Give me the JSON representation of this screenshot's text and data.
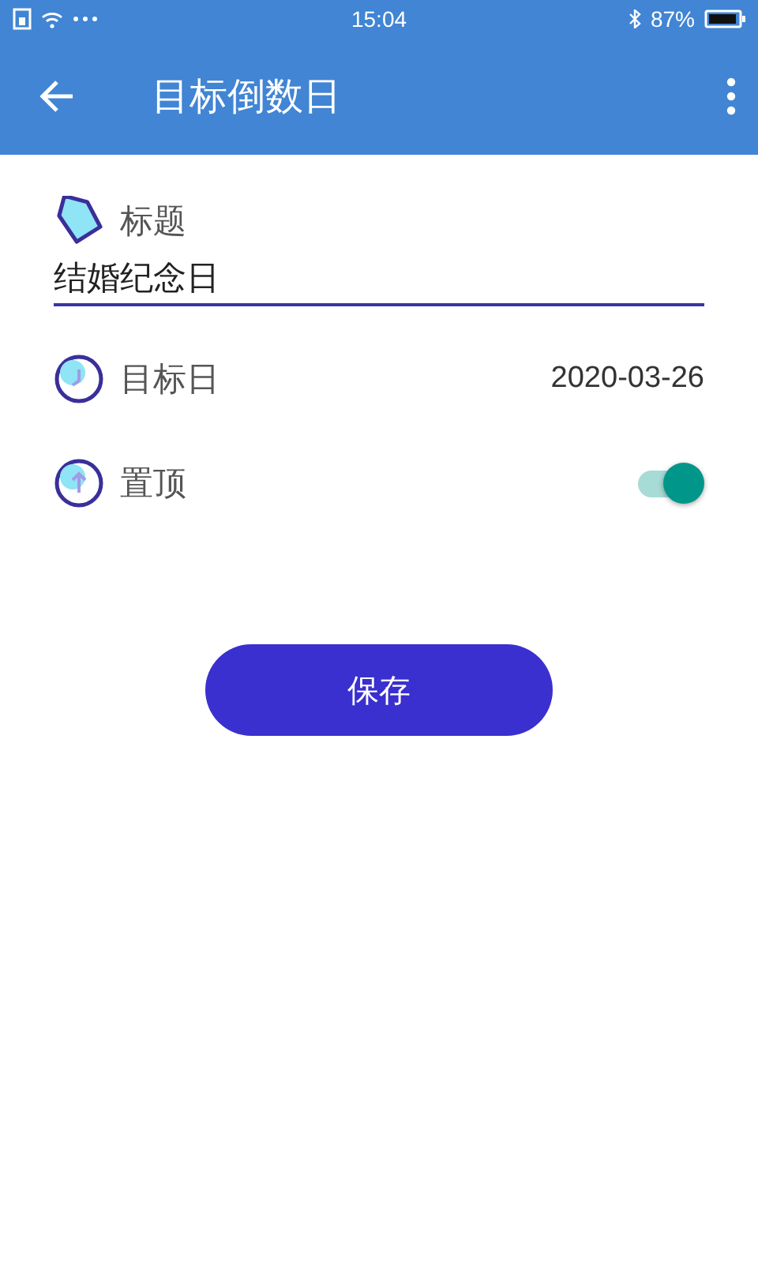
{
  "status_bar": {
    "time": "15:04",
    "battery": "87%"
  },
  "app_bar": {
    "title": "目标倒数日"
  },
  "form": {
    "title_label": "标题",
    "title_value": "结婚纪念日",
    "date_label": "目标日",
    "date_value": "2020-03-26",
    "pin": {
      "label": "置顶",
      "on": true
    }
  },
  "save_button": "保存"
}
